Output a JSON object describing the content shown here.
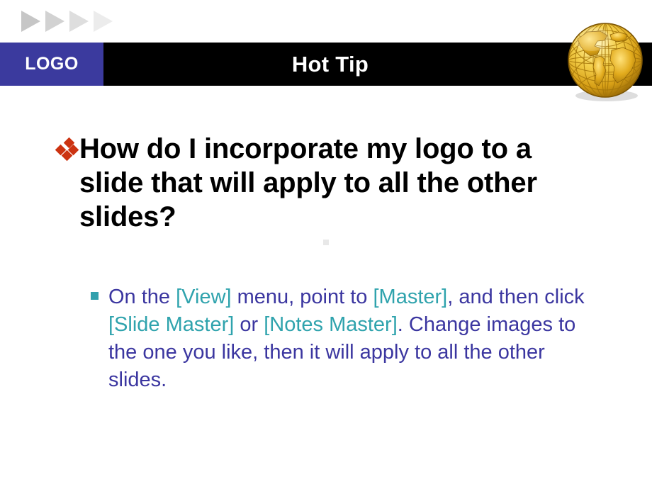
{
  "slide": {
    "title": "Hot Tip",
    "logo_label": "LOGO",
    "decor": {
      "arrow_icon": "triangle-right-icon",
      "arrow_count": 4,
      "arrow_colors": [
        "#c6c6c6",
        "#d2d2d2",
        "#dedede",
        "#ececec"
      ],
      "globe_icon": "globe-icon",
      "globe_colors": {
        "sphere_light": "#ffe680",
        "sphere_mid": "#e0a81f",
        "sphere_dark": "#a6760a",
        "grid": "#b8860b",
        "land": "#d9a316"
      }
    },
    "colors": {
      "logo_background": "#3b3a9e",
      "header_background": "#000000",
      "title_text": "#ffffff",
      "heading_text": "#000000",
      "heading_bullet": "#cc3311",
      "body_text": "#3b36a0",
      "body_keyword": "#2fa3ad",
      "body_bullet": "#31a0ad",
      "page_background": "#ffffff",
      "faint_marker": "#e8e8e8"
    },
    "heading": {
      "bullet_icon": "diamond-cluster-bullet-icon",
      "text": "How do I incorporate my logo to a slide that will apply to all the other slides?"
    },
    "body": {
      "bullet_icon": "square-bullet-icon",
      "segments": [
        {
          "text": "On the ",
          "style": "normal"
        },
        {
          "text": "[View]",
          "style": "keyword"
        },
        {
          "text": " menu, point to ",
          "style": "normal"
        },
        {
          "text": "[Master]",
          "style": "keyword"
        },
        {
          "text": ", and then click ",
          "style": "normal"
        },
        {
          "text": "[Slide Master]",
          "style": "keyword"
        },
        {
          "text": " or ",
          "style": "normal"
        },
        {
          "text": "[Notes Master]",
          "style": "keyword"
        },
        {
          "text": ". Change images to the one you like, then it will apply to all the other slides.",
          "style": "normal"
        }
      ],
      "plain_text": "On the [View] menu, point to [Master], and then click [Slide Master] or [Notes Master]. Change images to the one you like, then it will apply to all the other slides."
    }
  }
}
